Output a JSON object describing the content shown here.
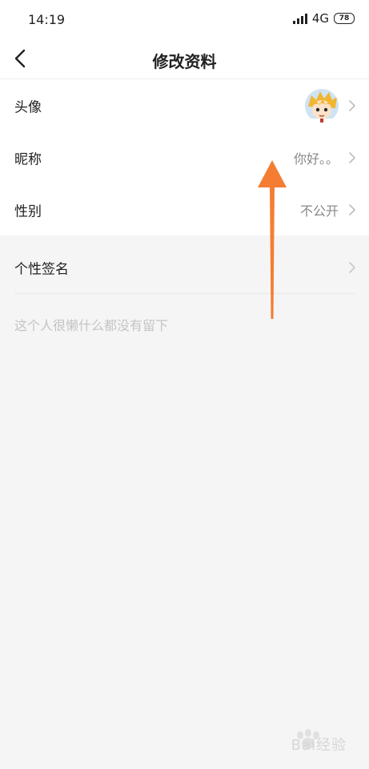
{
  "status_bar": {
    "time": "14:19",
    "network": "4G",
    "battery": "78"
  },
  "nav": {
    "title": "修改资料"
  },
  "rows": [
    {
      "label": "头像"
    },
    {
      "label": "昵称",
      "value": "你好。。"
    },
    {
      "label": "性别",
      "value": "不公开"
    }
  ],
  "signature": {
    "label": "个性签名",
    "value": "这个人很懒什么都没有留下"
  },
  "annotation": {
    "arrow_color": "#f47d33"
  },
  "watermark": {
    "text": "Bai经验"
  }
}
